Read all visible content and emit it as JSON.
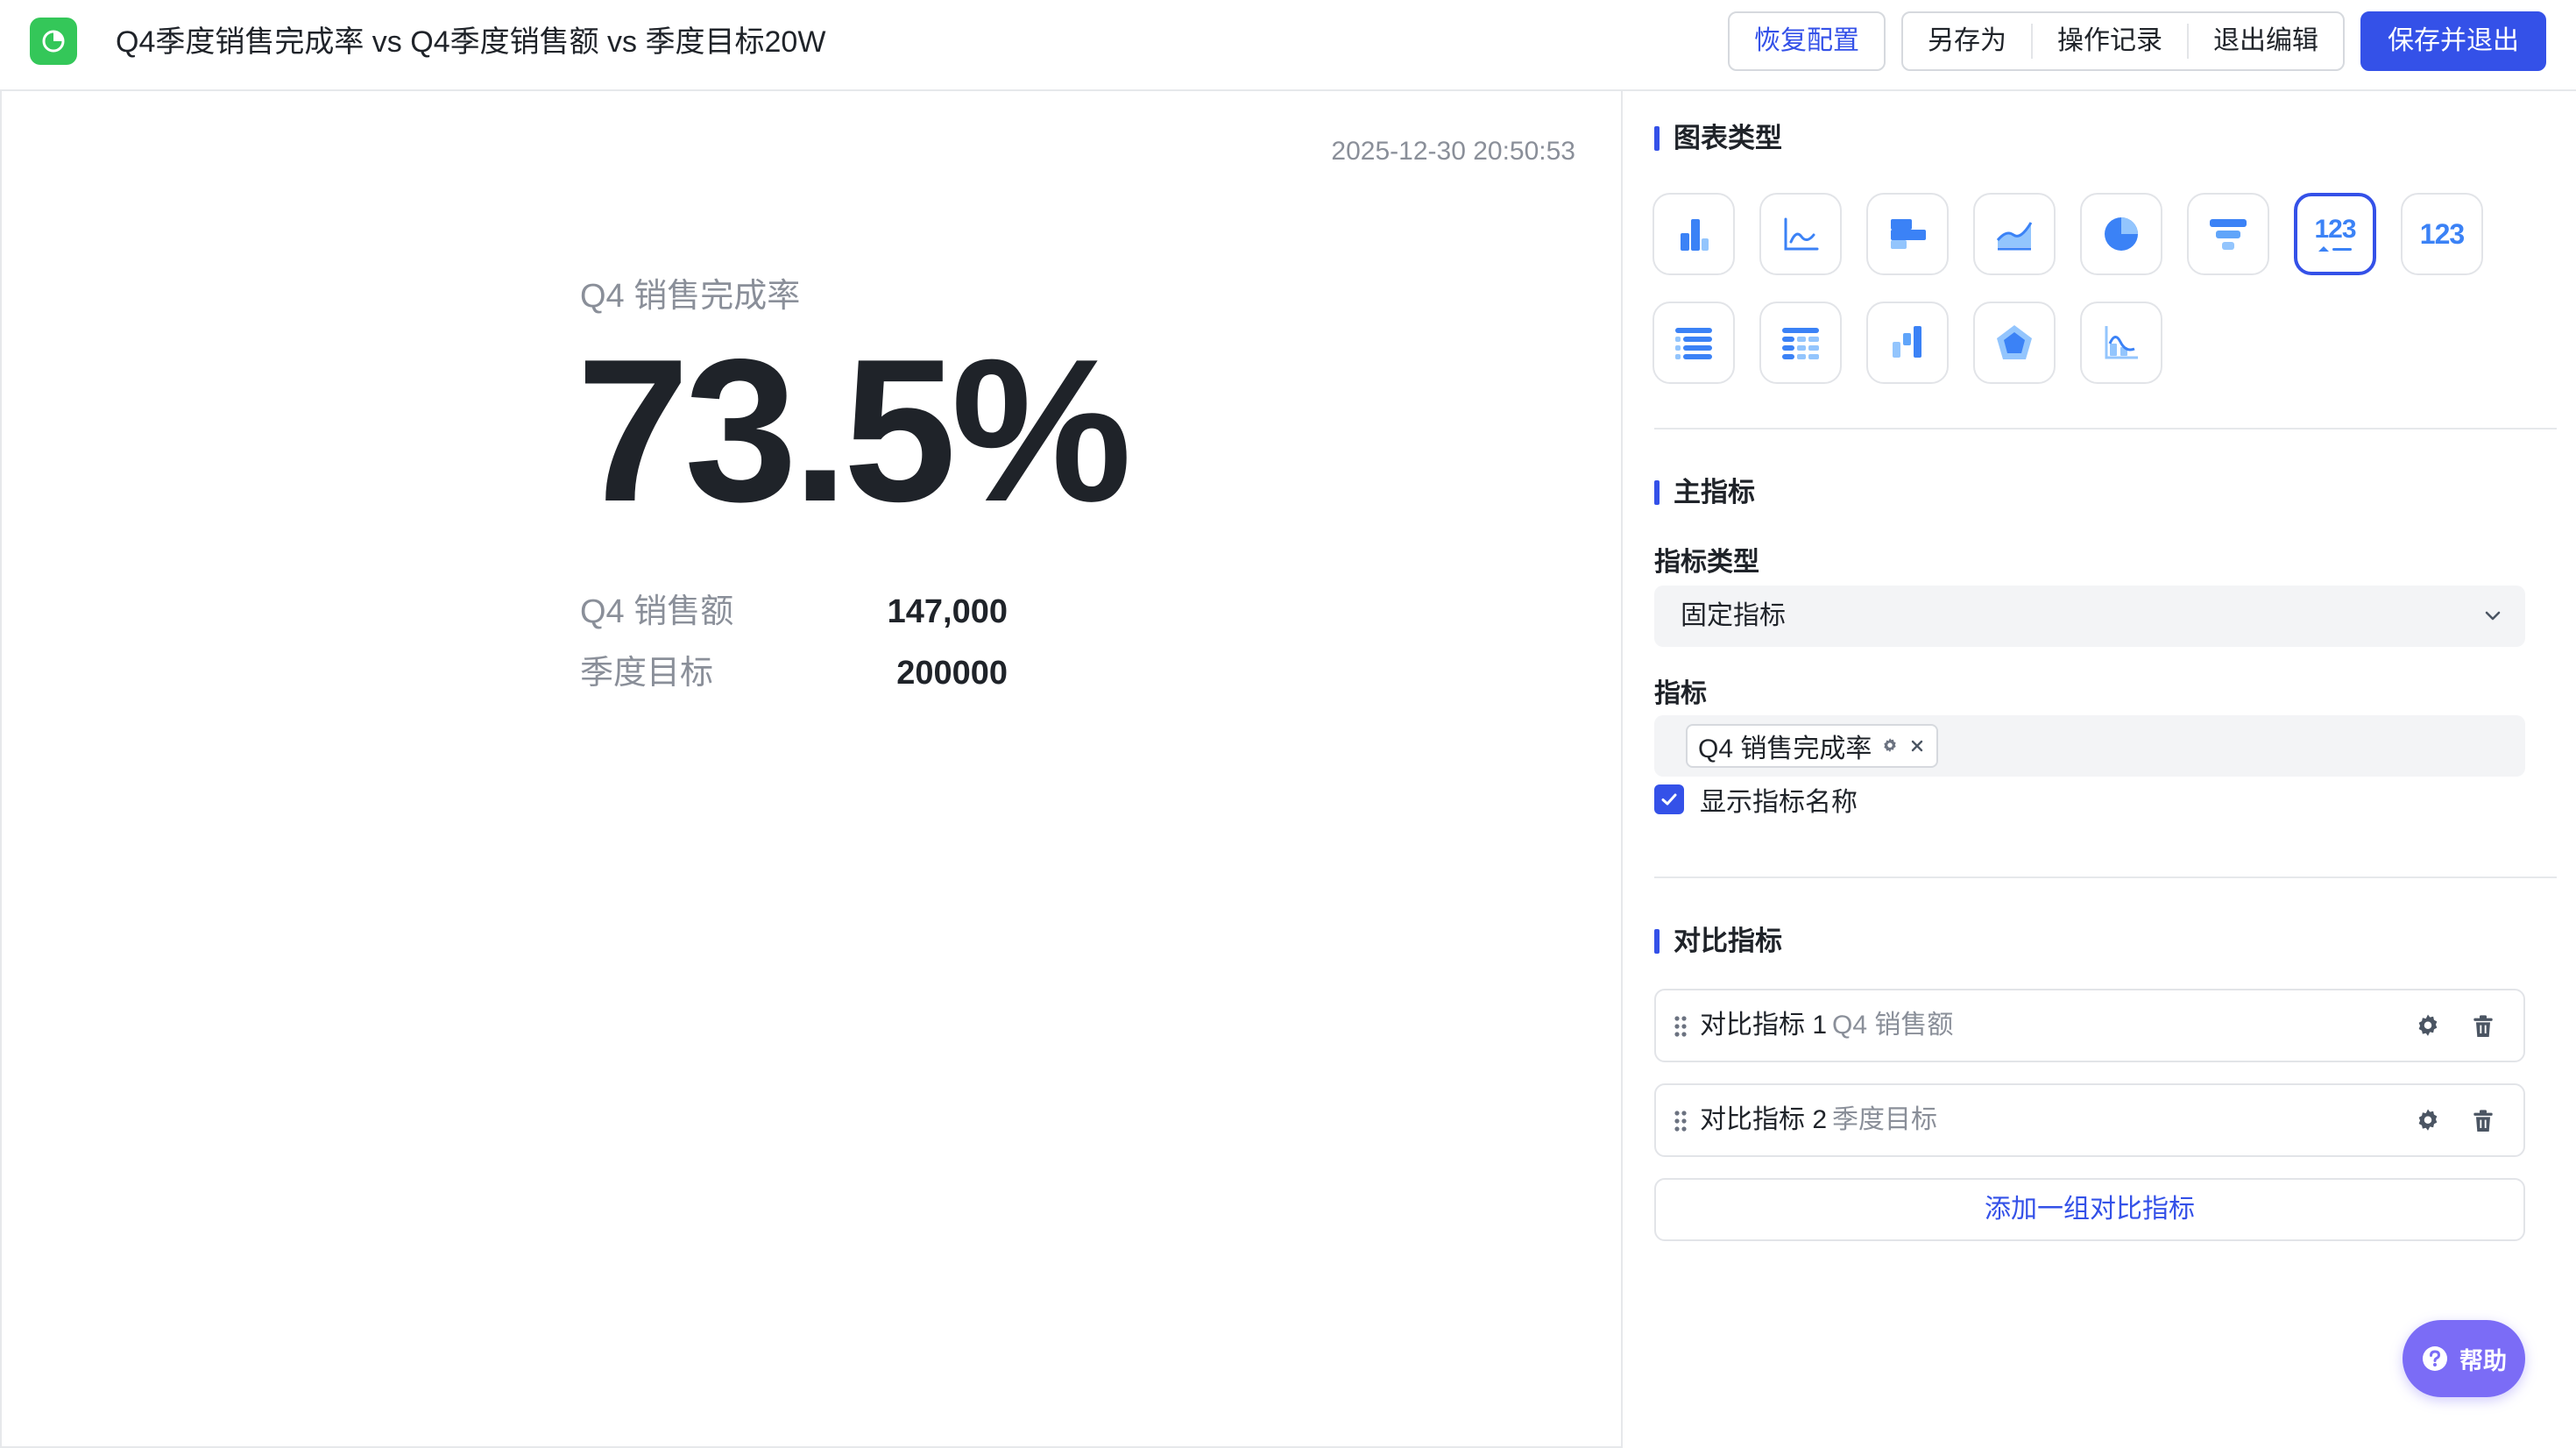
{
  "header": {
    "title": "Q4季度销售完成率 vs Q4季度销售额 vs 季度目标20W",
    "restore_label": "恢复配置",
    "save_as_label": "另存为",
    "history_label": "操作记录",
    "exit_edit_label": "退出编辑",
    "save_exit_label": "保存并退出",
    "accent_color": "#3451e8"
  },
  "canvas": {
    "timestamp": "2025-12-30 20:50:53",
    "metric_name": "Q4 销售完成率",
    "metric_value": "73.5%",
    "comparisons": [
      {
        "label": "Q4 销售额",
        "value": "147,000"
      },
      {
        "label": "季度目标",
        "value": "200000"
      }
    ]
  },
  "panel": {
    "chart_type_title": "图表类型",
    "chart_types": [
      {
        "icon": "bar-chart-icon"
      },
      {
        "icon": "line-chart-icon"
      },
      {
        "icon": "horizontal-bar-chart-icon"
      },
      {
        "icon": "area-chart-icon"
      },
      {
        "icon": "pie-chart-icon"
      },
      {
        "icon": "funnel-chart-icon"
      },
      {
        "icon": "indicator-card-icon",
        "label": "123",
        "active": true
      },
      {
        "icon": "number-card-icon",
        "label": "123"
      },
      {
        "icon": "table-icon"
      },
      {
        "icon": "pivot-table-icon"
      },
      {
        "icon": "waterfall-chart-icon"
      },
      {
        "icon": "radar-chart-icon"
      },
      {
        "icon": "combo-chart-icon"
      }
    ],
    "main_metric_title": "主指标",
    "metric_type_label": "指标类型",
    "metric_type_value": "固定指标",
    "metric_label": "指标",
    "metric_tag": "Q4 销售完成率",
    "show_name_label": "显示指标名称",
    "show_name_checked": true,
    "compare_title": "对比指标",
    "compare_items": [
      {
        "name": "对比指标 1",
        "metric": "Q4 销售额"
      },
      {
        "name": "对比指标 2",
        "metric": "季度目标"
      }
    ],
    "add_compare_label": "添加一组对比指标",
    "help_label": "帮助",
    "help_color": "#7b6cf6"
  }
}
